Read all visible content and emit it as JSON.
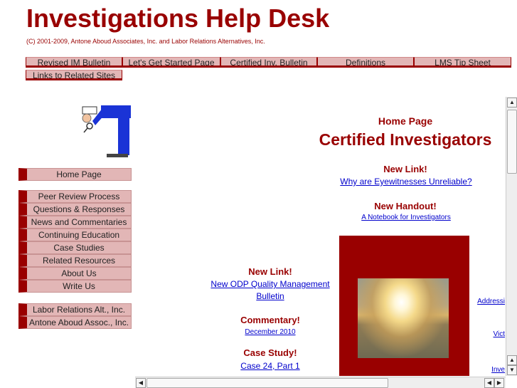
{
  "header": {
    "title": "Investigations Help Desk",
    "copyright": "(C) 2001-2009, Antone Aboud Associates, Inc. and Labor Relations Alternatives, Inc."
  },
  "nav": [
    {
      "label": "Revised IM Bulletin"
    },
    {
      "label": "Let's Get Started Page"
    },
    {
      "label": "Certified Inv. Bulletin"
    },
    {
      "label": "Definitions"
    },
    {
      "label": "LMS Tip Sheet"
    },
    {
      "label": "Links to Related Sites"
    }
  ],
  "sidebar": {
    "home": "Home Page",
    "items": [
      {
        "label": "Peer Review Process"
      },
      {
        "label": "Questions & Responses"
      },
      {
        "label": "News and Commentaries"
      },
      {
        "label": "Continuing Education"
      },
      {
        "label": "Case Studies"
      },
      {
        "label": "Related Resources"
      },
      {
        "label": "About Us"
      },
      {
        "label": "Write Us"
      }
    ],
    "partners": [
      {
        "label": "Labor Relations Alt., Inc."
      },
      {
        "label": "Antone Aboud Assoc., Inc."
      }
    ]
  },
  "main": {
    "page_label": "Home Page",
    "page_title": "Certified Investigators",
    "new_link_1": {
      "heading": "New Link!",
      "link": "Why are Eyewitnesses Unreliable?"
    },
    "new_handout": {
      "heading": "New Handout!",
      "link": "A Notebook for Investigators"
    },
    "new_link_2": {
      "heading": "New Link!",
      "link_line1": "New ODP Quality Management",
      "link_line2": "Bulletin"
    },
    "commentary": {
      "heading": "Commentary!",
      "link": "December 2010"
    },
    "case_study": {
      "heading": "Case Study!",
      "link": "Case 24, Part 1"
    },
    "cut_links": [
      {
        "label": "Addressi"
      },
      {
        "label": "Vict"
      },
      {
        "label": "Inve"
      }
    ]
  },
  "colors": {
    "brand": "#990000",
    "button_fill": "#e2b6b6",
    "link": "#0000cc"
  }
}
